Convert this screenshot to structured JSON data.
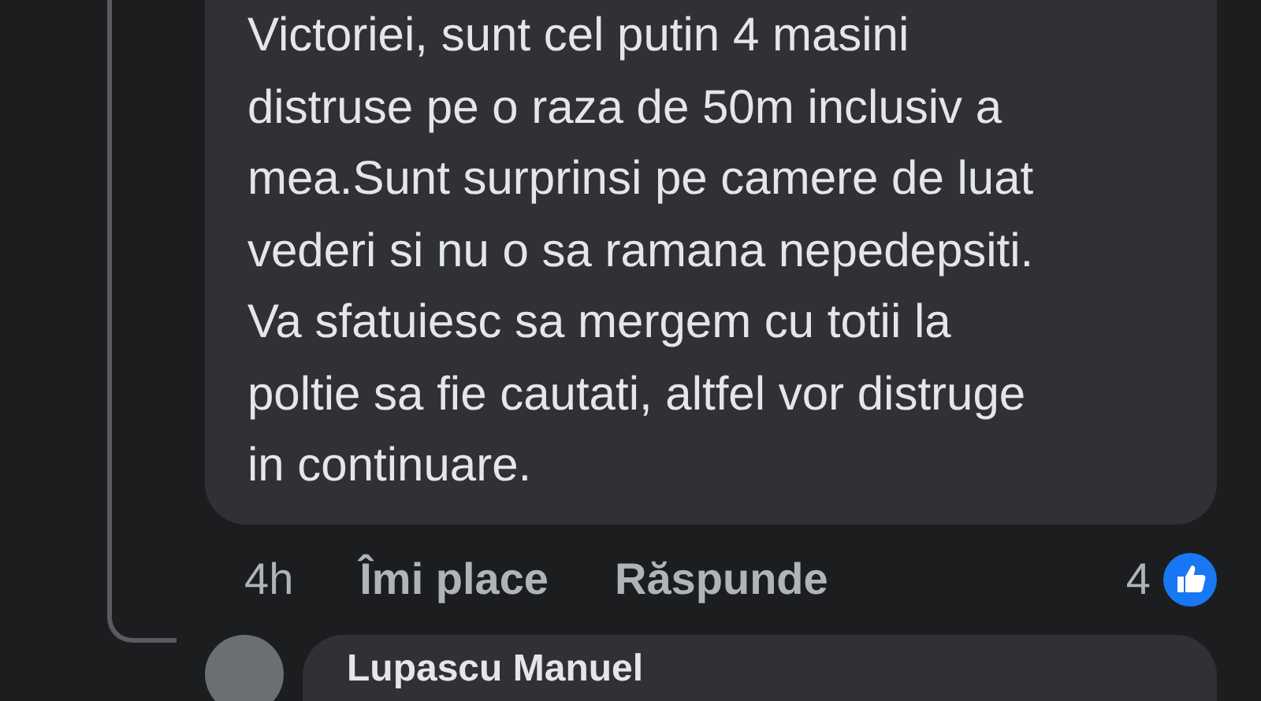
{
  "comment": {
    "text": "Victoriei, sunt cel putin 4 masini\ndistruse pe o raza de 50m inclusiv a\nmea.Sunt surprinsi pe camere de luat\nvederi si nu o sa ramana nepedepsiti.\nVa sfatuiesc sa mergem cu totii la\npoltie sa fie cautati, altfel vor distruge\nin continuare.",
    "time": "4h",
    "actions": [
      "Îmi place",
      "Răspunde"
    ],
    "reaction_count": "4"
  },
  "reply": {
    "author": "Lupascu Manuel"
  }
}
